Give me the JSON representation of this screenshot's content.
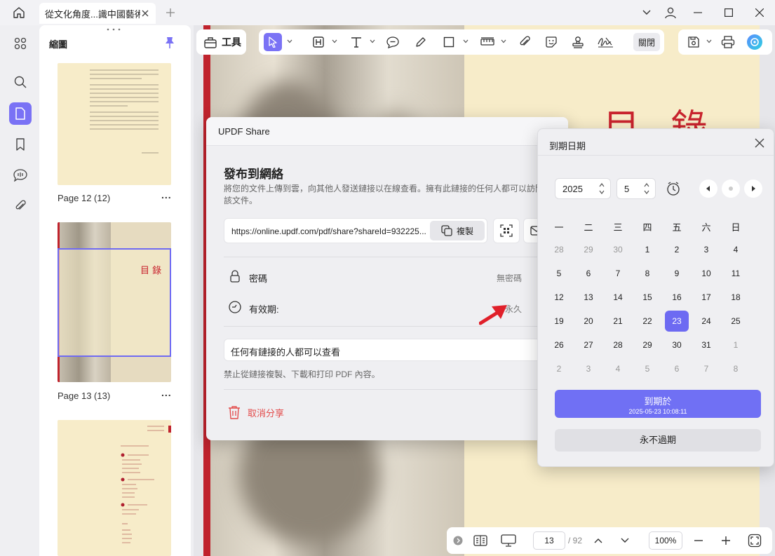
{
  "titlebar": {
    "tab_title": "從文化角度...識中國藝術"
  },
  "thumbnails": {
    "title": "縮圖",
    "pages": [
      {
        "label": "Page 12 (12)"
      },
      {
        "label": "Page 13 (13)",
        "heading": "目 錄"
      },
      {
        "label": ""
      }
    ],
    "more": "..."
  },
  "toolbar": {
    "tools_label": "工具",
    "close_label": "關閉"
  },
  "pdf": {
    "heading": "目 錄"
  },
  "bottombar": {
    "page": "13",
    "total": "/ 92",
    "zoom": "100%"
  },
  "share": {
    "header": "UPDF Share",
    "heading": "發布到網絡",
    "description": "將您的文件上傳到雲，向其他人發送鏈接以在線查看。擁有此鏈接的任何人都可以訪問該文件。",
    "url": "https://online.updf.com/pdf/share?shareId=932225...",
    "copy_label": "複製",
    "password_label": "密碼",
    "password_value": "無密碼",
    "validity_label": "有效期:",
    "validity_value": "永久",
    "permission": "任何有鏈接的人都可以查看",
    "note": "禁止從鏈接複製、下載和打印 PDF 內容。",
    "cancel_label": "取消分享"
  },
  "datepicker": {
    "title": "到期日期",
    "year": "2025",
    "month": "5",
    "weekdays": [
      "一",
      "二",
      "三",
      "四",
      "五",
      "六",
      "日"
    ],
    "weeks": [
      [
        "28",
        "29",
        "30",
        "1",
        "2",
        "3",
        "4"
      ],
      [
        "5",
        "6",
        "7",
        "8",
        "9",
        "10",
        "11"
      ],
      [
        "12",
        "13",
        "14",
        "15",
        "16",
        "17",
        "18"
      ],
      [
        "19",
        "20",
        "21",
        "22",
        "23",
        "24",
        "25"
      ],
      [
        "26",
        "27",
        "28",
        "29",
        "30",
        "31",
        "1"
      ],
      [
        "2",
        "3",
        "4",
        "5",
        "6",
        "7",
        "8"
      ]
    ],
    "other_month_flags": [
      [
        true,
        true,
        true,
        false,
        false,
        false,
        false
      ],
      [
        false,
        false,
        false,
        false,
        false,
        false,
        false
      ],
      [
        false,
        false,
        false,
        false,
        false,
        false,
        false
      ],
      [
        false,
        false,
        false,
        false,
        false,
        false,
        false
      ],
      [
        false,
        false,
        false,
        false,
        false,
        false,
        true
      ],
      [
        true,
        true,
        true,
        true,
        true,
        true,
        true
      ]
    ],
    "selected_day": "23",
    "expire_label": "到期於",
    "expire_datetime": "2025-05-23 10:08:11",
    "never_label": "永不過期"
  },
  "colors": {
    "accent": "#7a72f5",
    "danger": "#e34b4b",
    "page_red": "#c8232d",
    "page_bg": "#f7ecc9"
  }
}
